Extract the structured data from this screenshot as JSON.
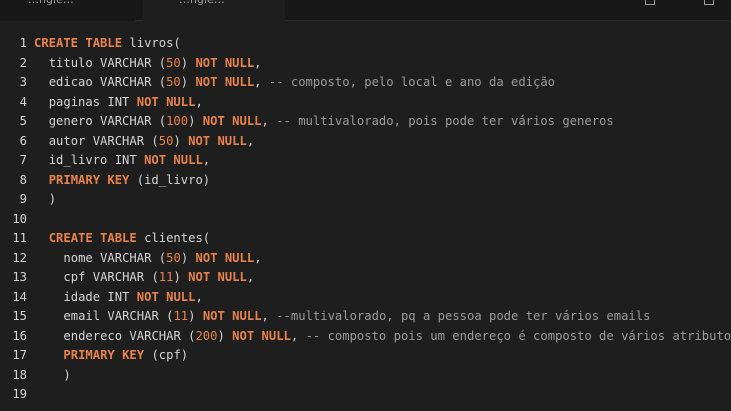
{
  "tabs": [
    {
      "label": "…ngle…"
    },
    {
      "label": "…ngle…"
    }
  ],
  "colors": {
    "background": "#1e1e1e",
    "text": "#d4d4d4",
    "keyword": "#e8824c",
    "number": "#e8824c",
    "comment": "#9b9b9b"
  },
  "lines": [
    {
      "num": "1",
      "indent": 0,
      "tokens": [
        {
          "t": "kw",
          "v": "CREATE TABLE"
        },
        {
          "t": "txt",
          "v": " livros("
        }
      ]
    },
    {
      "num": "2",
      "indent": 2,
      "tokens": [
        {
          "t": "txt",
          "v": "titulo VARCHAR ("
        },
        {
          "t": "num",
          "v": "50"
        },
        {
          "t": "txt",
          "v": ") "
        },
        {
          "t": "kw",
          "v": "NOT NULL"
        },
        {
          "t": "txt",
          "v": ","
        }
      ]
    },
    {
      "num": "3",
      "indent": 2,
      "tokens": [
        {
          "t": "txt",
          "v": "edicao VARCHAR ("
        },
        {
          "t": "num",
          "v": "50"
        },
        {
          "t": "txt",
          "v": ") "
        },
        {
          "t": "kw",
          "v": "NOT NULL"
        },
        {
          "t": "txt",
          "v": ", "
        },
        {
          "t": "cmt",
          "v": "-- composto, pelo local e ano da edição"
        }
      ]
    },
    {
      "num": "4",
      "indent": 2,
      "tokens": [
        {
          "t": "txt",
          "v": "paginas INT "
        },
        {
          "t": "kw",
          "v": "NOT NULL"
        },
        {
          "t": "txt",
          "v": ","
        }
      ]
    },
    {
      "num": "5",
      "indent": 2,
      "tokens": [
        {
          "t": "txt",
          "v": "genero VARCHAR ("
        },
        {
          "t": "num",
          "v": "100"
        },
        {
          "t": "txt",
          "v": ") "
        },
        {
          "t": "kw",
          "v": "NOT NULL"
        },
        {
          "t": "txt",
          "v": ", "
        },
        {
          "t": "cmt",
          "v": "-- multivalorado, pois pode ter vários generos"
        }
      ]
    },
    {
      "num": "6",
      "indent": 2,
      "tokens": [
        {
          "t": "txt",
          "v": "autor VARCHAR ("
        },
        {
          "t": "num",
          "v": "50"
        },
        {
          "t": "txt",
          "v": ") "
        },
        {
          "t": "kw",
          "v": "NOT NULL"
        },
        {
          "t": "txt",
          "v": ","
        }
      ]
    },
    {
      "num": "7",
      "indent": 2,
      "tokens": [
        {
          "t": "txt",
          "v": "id_livro INT "
        },
        {
          "t": "kw",
          "v": "NOT NULL"
        },
        {
          "t": "txt",
          "v": ","
        }
      ]
    },
    {
      "num": "8",
      "indent": 2,
      "tokens": [
        {
          "t": "kw",
          "v": "PRIMARY KEY"
        },
        {
          "t": "txt",
          "v": " (id_livro)"
        }
      ]
    },
    {
      "num": "9",
      "indent": 2,
      "tokens": [
        {
          "t": "txt",
          "v": ")"
        }
      ]
    },
    {
      "num": "10",
      "indent": 0,
      "tokens": []
    },
    {
      "num": "11",
      "indent": 2,
      "tokens": [
        {
          "t": "kw",
          "v": "CREATE TABLE"
        },
        {
          "t": "txt",
          "v": " clientes("
        }
      ]
    },
    {
      "num": "12",
      "indent": 4,
      "tokens": [
        {
          "t": "txt",
          "v": "nome VARCHAR ("
        },
        {
          "t": "num",
          "v": "50"
        },
        {
          "t": "txt",
          "v": ") "
        },
        {
          "t": "kw",
          "v": "NOT NULL"
        },
        {
          "t": "txt",
          "v": ","
        }
      ]
    },
    {
      "num": "13",
      "indent": 4,
      "tokens": [
        {
          "t": "txt",
          "v": "cpf VARCHAR ("
        },
        {
          "t": "num",
          "v": "11"
        },
        {
          "t": "txt",
          "v": ") "
        },
        {
          "t": "kw",
          "v": "NOT NULL"
        },
        {
          "t": "txt",
          "v": ","
        }
      ]
    },
    {
      "num": "14",
      "indent": 4,
      "tokens": [
        {
          "t": "txt",
          "v": "idade INT "
        },
        {
          "t": "kw",
          "v": "NOT NULL"
        },
        {
          "t": "txt",
          "v": ","
        }
      ]
    },
    {
      "num": "15",
      "indent": 4,
      "tokens": [
        {
          "t": "txt",
          "v": "email VARCHAR ("
        },
        {
          "t": "num",
          "v": "11"
        },
        {
          "t": "txt",
          "v": ") "
        },
        {
          "t": "kw",
          "v": "NOT NULL"
        },
        {
          "t": "txt",
          "v": ", "
        },
        {
          "t": "cmt",
          "v": "--multivalorado, pq a pessoa pode ter vários emails"
        }
      ]
    },
    {
      "num": "16",
      "indent": 4,
      "tokens": [
        {
          "t": "txt",
          "v": "endereco VARCHAR ("
        },
        {
          "t": "num",
          "v": "200"
        },
        {
          "t": "txt",
          "v": ") "
        },
        {
          "t": "kw",
          "v": "NOT NULL"
        },
        {
          "t": "txt",
          "v": ", "
        },
        {
          "t": "cmt",
          "v": "-- composto pois um endereço é composto de vários atributos"
        }
      ]
    },
    {
      "num": "17",
      "indent": 4,
      "tokens": [
        {
          "t": "kw",
          "v": "PRIMARY KEY"
        },
        {
          "t": "txt",
          "v": " (cpf)"
        }
      ]
    },
    {
      "num": "18",
      "indent": 4,
      "tokens": [
        {
          "t": "txt",
          "v": ")"
        }
      ]
    },
    {
      "num": "19",
      "indent": 0,
      "tokens": []
    }
  ]
}
